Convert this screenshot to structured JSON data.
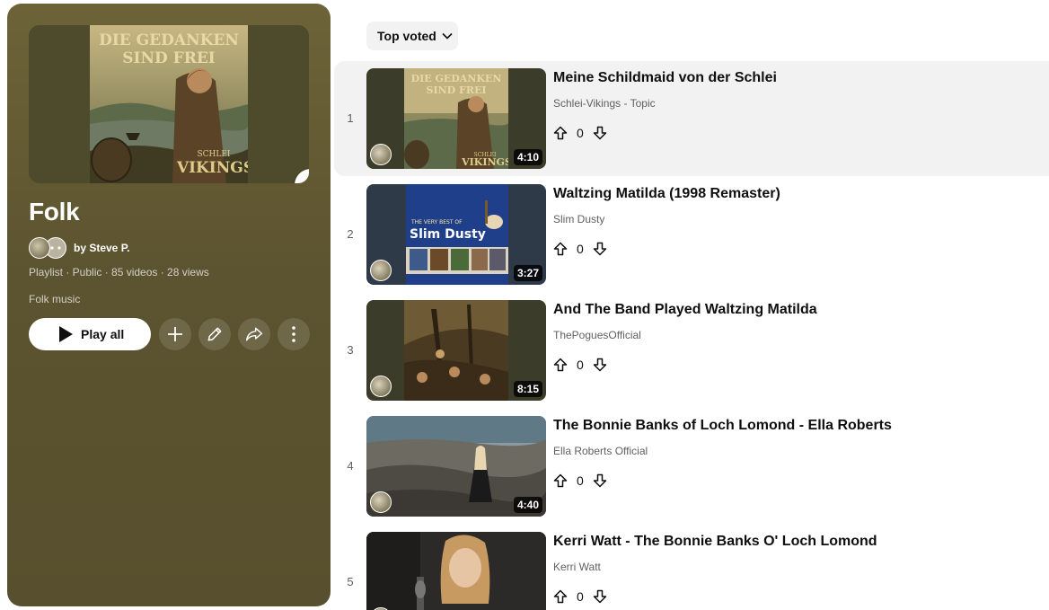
{
  "playlist": {
    "cover_title_line1": "DIE GEDANKEN",
    "cover_title_line2": "SIND FREI",
    "cover_logo_line1": "SCHLEI",
    "cover_logo_line2": "VIKINGS",
    "title": "Folk",
    "owner": "by Steve P.",
    "meta": "Playlist · Public · 85 videos · 28 views",
    "description": "Folk music",
    "play_all_label": "Play all",
    "icons": {
      "edit_cover": "pencil-icon",
      "play": "play-icon",
      "add": "plus-icon",
      "edit": "pencil-icon",
      "share": "share-icon",
      "more": "more-vert-icon"
    }
  },
  "sort": {
    "label": "Top voted",
    "icon": "chevron-down-icon"
  },
  "videos": [
    {
      "index": "1",
      "title": "Meine Schildmaid von der Schlei",
      "channel": "Schlei-Vikings - Topic",
      "duration": "4:10",
      "votes": "0"
    },
    {
      "index": "2",
      "title": "Waltzing Matilda (1998 Remaster)",
      "channel": "Slim Dusty",
      "duration": "3:27",
      "votes": "0"
    },
    {
      "index": "3",
      "title": "And The Band Played Waltzing Matilda",
      "channel": "ThePoguesOfficial",
      "duration": "8:15",
      "votes": "0"
    },
    {
      "index": "4",
      "title": "The Bonnie Banks of Loch Lomond - Ella Roberts",
      "channel": "Ella Roberts Official",
      "duration": "4:40",
      "votes": "0"
    },
    {
      "index": "5",
      "title": "Kerri Watt - The Bonnie Banks O' Loch Lomond",
      "channel": "Kerri Watt",
      "duration": "",
      "votes": "0"
    }
  ],
  "thumb_text": {
    "v2_line1": "THE VERY BEST OF",
    "v2_line2": "Slim Dusty"
  },
  "colors": {
    "panel": "#5c5430",
    "active_row": "#f2f2f2",
    "muted_text": "#606060"
  }
}
